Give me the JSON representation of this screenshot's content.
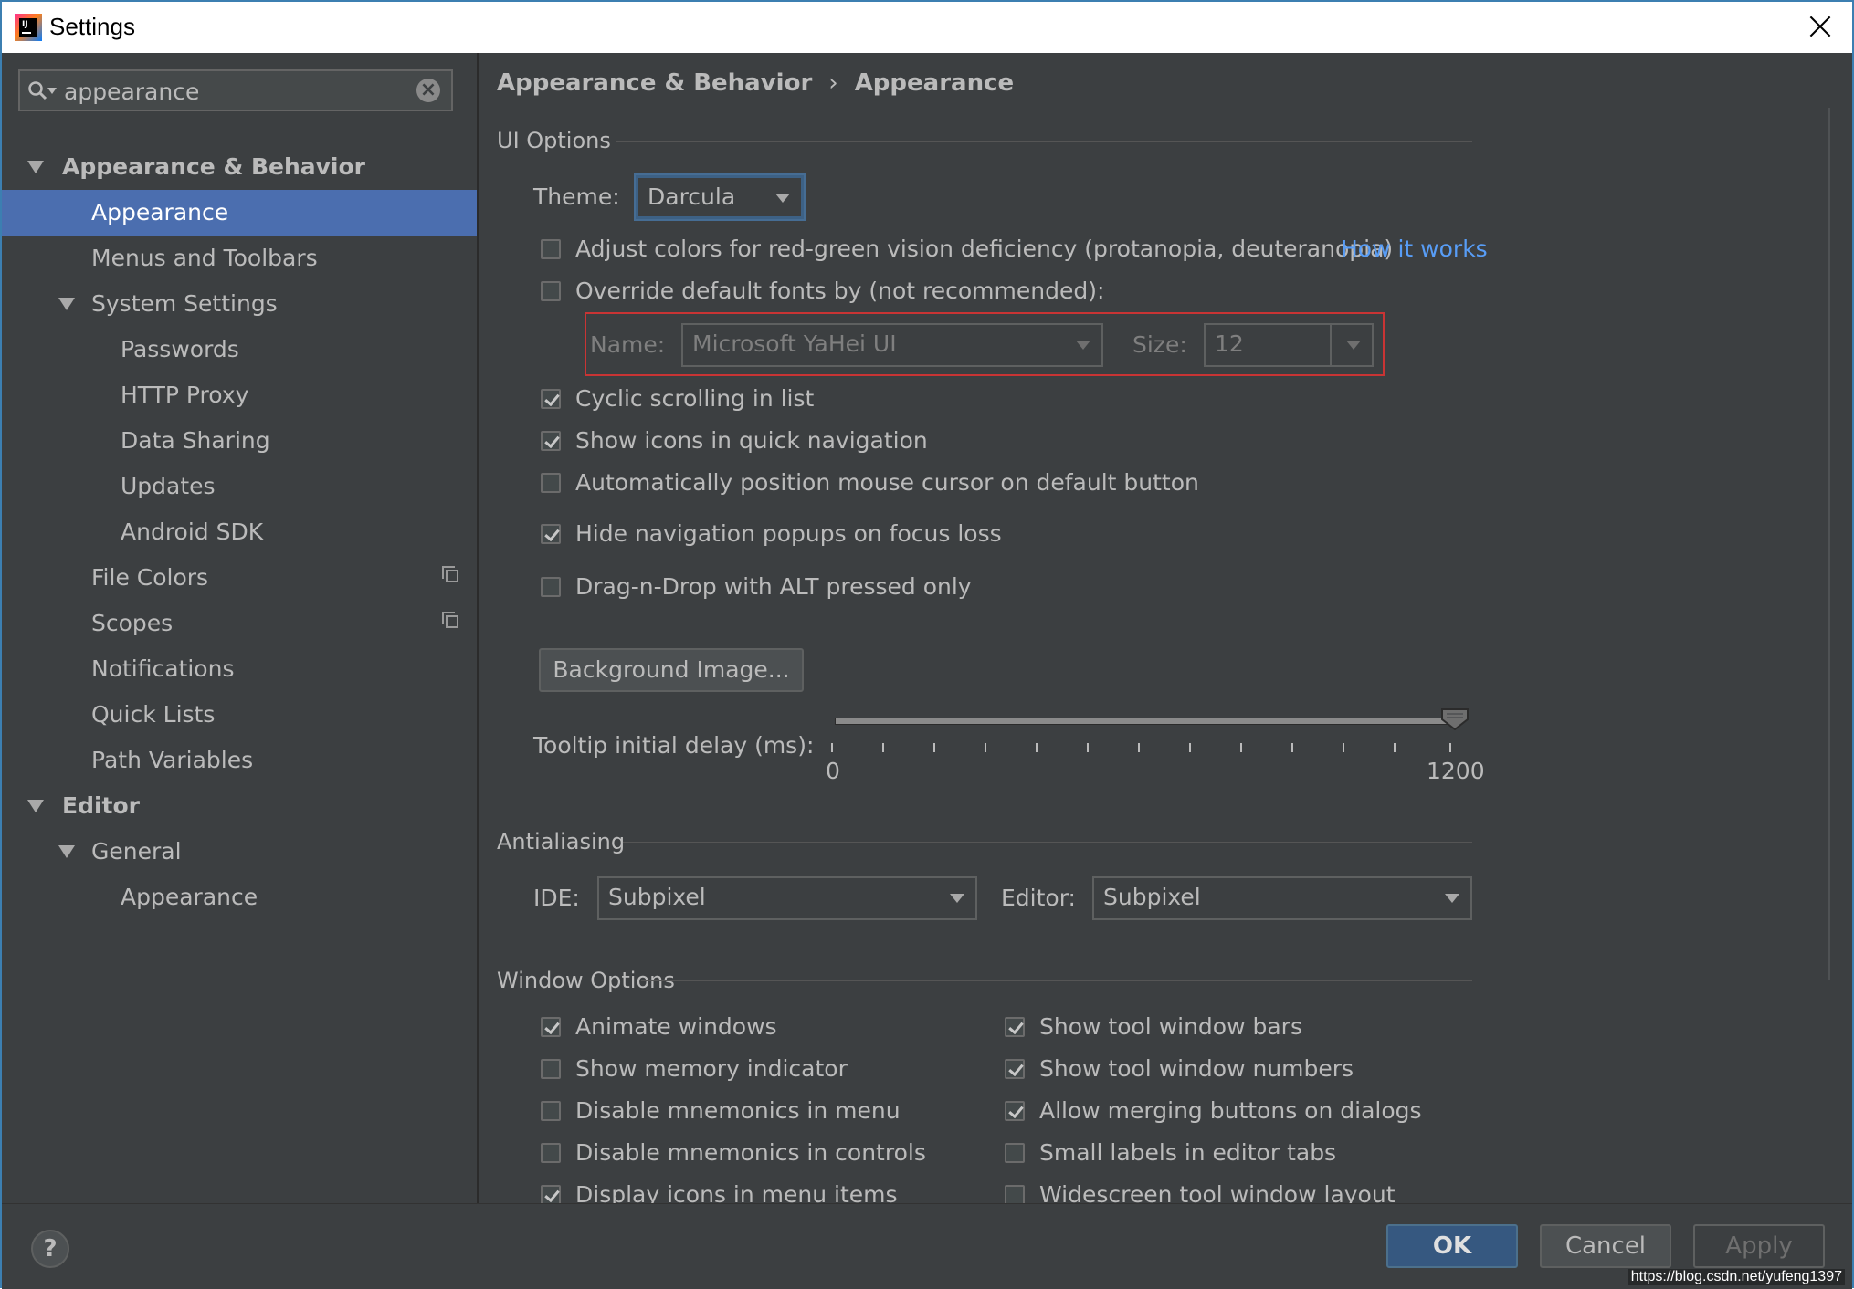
{
  "window": {
    "title": "Settings"
  },
  "search": {
    "value": "appearance"
  },
  "sidebar": {
    "items": [
      {
        "label": "Appearance & Behavior"
      },
      {
        "label": "Appearance"
      },
      {
        "label": "Menus and Toolbars"
      },
      {
        "label": "System Settings"
      },
      {
        "label": "Passwords"
      },
      {
        "label": "HTTP Proxy"
      },
      {
        "label": "Data Sharing"
      },
      {
        "label": "Updates"
      },
      {
        "label": "Android SDK"
      },
      {
        "label": "File Colors"
      },
      {
        "label": "Scopes"
      },
      {
        "label": "Notifications"
      },
      {
        "label": "Quick Lists"
      },
      {
        "label": "Path Variables"
      },
      {
        "label": "Editor"
      },
      {
        "label": "General"
      },
      {
        "label": "Appearance"
      }
    ]
  },
  "breadcrumb": {
    "parent": "Appearance & Behavior",
    "separator": "›",
    "current": "Appearance"
  },
  "ui_options": {
    "title": "UI Options",
    "theme_label": "Theme:",
    "theme_value": "Darcula",
    "adjust_colors": {
      "label": "Adjust colors for red-green vision deficiency (protanopia, deuteranopia)",
      "checked": false
    },
    "how_it_works": "How it works",
    "override_fonts": {
      "label": "Override default fonts by (not recommended):",
      "checked": false
    },
    "font_name_label": "Name:",
    "font_name_value": "Microsoft YaHei UI",
    "font_size_label": "Size:",
    "font_size_value": "12",
    "cyclic_scrolling": {
      "label": "Cyclic scrolling in list",
      "checked": true
    },
    "show_icons_quick_nav": {
      "label": "Show icons in quick navigation",
      "checked": true
    },
    "auto_position_mouse": {
      "label": "Automatically position mouse cursor on default button",
      "checked": false
    },
    "hide_nav_popups": {
      "label": "Hide navigation popups on focus loss",
      "checked": true
    },
    "drag_n_drop_alt": {
      "label": "Drag-n-Drop with ALT pressed only",
      "checked": false
    },
    "background_image_button": "Background Image...",
    "tooltip_label": "Tooltip initial delay (ms):",
    "tooltip_min": "0",
    "tooltip_max": "1200",
    "tooltip_value": 1200
  },
  "antialiasing": {
    "title": "Antialiasing",
    "ide_label": "IDE:",
    "ide_value": "Subpixel",
    "editor_label": "Editor:",
    "editor_value": "Subpixel"
  },
  "window_options": {
    "title": "Window Options",
    "left": [
      {
        "label": "Animate windows",
        "checked": true
      },
      {
        "label": "Show memory indicator",
        "checked": false
      },
      {
        "label": "Disable mnemonics in menu",
        "checked": false
      },
      {
        "label": "Disable mnemonics in controls",
        "checked": false
      },
      {
        "label": "Display icons in menu items",
        "checked": true
      }
    ],
    "right": [
      {
        "label": "Show tool window bars",
        "checked": true
      },
      {
        "label": "Show tool window numbers",
        "checked": true
      },
      {
        "label": "Allow merging buttons on dialogs",
        "checked": true
      },
      {
        "label": "Small labels in editor tabs",
        "checked": false
      },
      {
        "label": "Widescreen tool window layout",
        "checked": false
      }
    ]
  },
  "footer": {
    "help": "?",
    "ok": "OK",
    "cancel": "Cancel",
    "apply": "Apply"
  },
  "watermark": "https://blog.csdn.net/yufeng1397",
  "colors": {
    "background": "#3c3f41",
    "selection": "#4b6eaf",
    "link": "#589df6",
    "primary_button": "#365880"
  }
}
